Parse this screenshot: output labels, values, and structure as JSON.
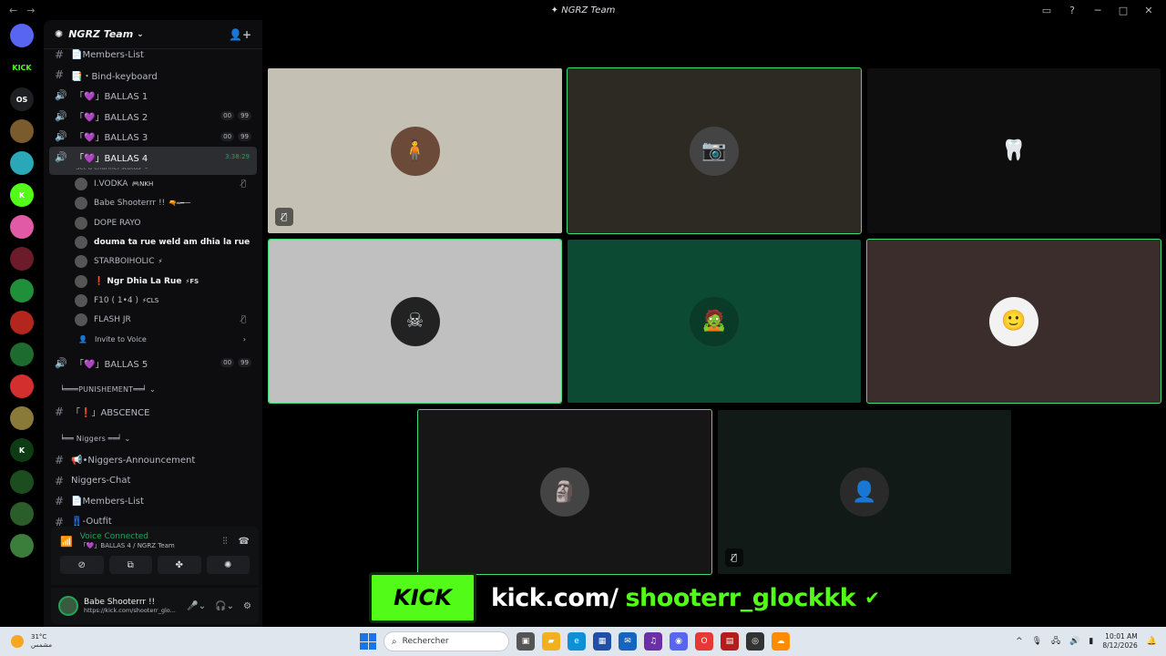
{
  "window": {
    "title": "NGRZ Team"
  },
  "rail": {
    "servers": [
      {
        "label": "",
        "color": "#5865f2",
        "icon": "discord-icon"
      },
      {
        "label": "KICK",
        "color": "#000000",
        "icon": "kick-logo"
      },
      {
        "label": "OS",
        "color": "#1e1f22",
        "icon": ""
      },
      {
        "label": "",
        "color": "#7a5b2e",
        "icon": ""
      },
      {
        "label": "",
        "color": "#2aa8b8",
        "icon": ""
      },
      {
        "label": "K",
        "color": "#53fc18",
        "icon": ""
      },
      {
        "label": "",
        "color": "#e05aa6",
        "icon": ""
      },
      {
        "label": "",
        "color": "#6b1b2a",
        "icon": ""
      },
      {
        "label": "",
        "color": "#1f8f3a",
        "icon": ""
      },
      {
        "label": "",
        "color": "#b3261e",
        "icon": ""
      },
      {
        "label": "",
        "color": "#1d6b2e",
        "icon": ""
      },
      {
        "label": "",
        "color": "#d32f2f",
        "icon": ""
      },
      {
        "label": "",
        "color": "#8a7a3a",
        "icon": ""
      },
      {
        "label": "K",
        "color": "#0d3b14",
        "icon": ""
      },
      {
        "label": "",
        "color": "#1b4d1e",
        "icon": ""
      },
      {
        "label": "",
        "color": "#2b5d2b",
        "icon": ""
      },
      {
        "label": "",
        "color": "#3b7d3b",
        "icon": ""
      }
    ]
  },
  "guild": {
    "name": "NGRZ Team"
  },
  "channels": {
    "members_list_top": "📄Members-List",
    "bind_keyboard": "📑・Bind-keyboard",
    "ballas1": "「💜」BALLAS 1",
    "ballas2": "「💜」BALLAS 2",
    "ballas3": "「💜」BALLAS 3",
    "ballas4": "「💜」BALLAS 4",
    "ballas4_timer": "3:38:29",
    "ballas4_status": "Set a channel status ✎",
    "ballas5": "「💜」BALLAS 5",
    "pill_a": "00",
    "pill_b": "99",
    "punishement_cat": "╘═══PUNISHEMENT══╛ ⌄",
    "abscence": "「❗」ABSCENCE",
    "niggers_cat": "╘══ Niggers ══╛ ⌄",
    "announcement": "📢•Niggers-Announcement",
    "chat": "Niggers-Chat",
    "members_list": "📄Members-List",
    "outfit": "👖-Outfit"
  },
  "voice_users": [
    {
      "name": "I.VODKA",
      "tag": "🎮NKH",
      "muted": true,
      "bold": false
    },
    {
      "name": "Babe Shooterrr !!",
      "tag": "🔫═━一",
      "muted": false,
      "bold": false
    },
    {
      "name": "DOPE RAYO",
      "tag": "",
      "muted": false,
      "bold": false
    },
    {
      "name": "douma ta rue weld am dhia la rue",
      "tag": "",
      "muted": false,
      "bold": true
    },
    {
      "name": "STARBOIHOLIC",
      "tag": "⚡",
      "muted": false,
      "bold": false
    },
    {
      "name": "❗ Ngr Dhia La Rue",
      "tag": "⚡FS",
      "muted": false,
      "bold": true
    },
    {
      "name": "F10 ( 1•4 )",
      "tag": "⚡CLS",
      "muted": false,
      "bold": false
    },
    {
      "name": "FLASH JR",
      "tag": "",
      "muted": true,
      "bold": false
    }
  ],
  "invite": "Invite to Voice",
  "voice_panel": {
    "title": "Voice Connected",
    "sub": "「💜」BALLAS 4 / NGRZ Team"
  },
  "user_panel": {
    "name": "Babe Shooterrr !!",
    "status": "https://kick.com/shooterr_glo..."
  },
  "tiles": [
    {
      "bg": "#c4c0b4",
      "avatar": "#6b4a3a",
      "glyph": "🧍",
      "speaking": false,
      "muted": true
    },
    {
      "bg": "#2c2a22",
      "avatar": "#444444",
      "glyph": "📷",
      "speaking": true,
      "muted": false
    },
    {
      "bg": "#0e0e0e",
      "avatar": "#0e0e0e",
      "glyph": "🦷",
      "speaking": false,
      "muted": false
    },
    {
      "bg": "#c0c0c0",
      "avatar": "#222222",
      "glyph": "☠",
      "speaking": true,
      "muted": false
    },
    {
      "bg": "#0c4a33",
      "avatar": "#0a3a28",
      "glyph": "🧟",
      "speaking": false,
      "muted": false
    },
    {
      "bg": "#3a2d2c",
      "avatar": "#f2f2f2",
      "glyph": "🙂",
      "speaking": true,
      "muted": false
    },
    {
      "bg": "#161616",
      "avatar": "#444444",
      "glyph": "🗿",
      "speaking": true,
      "muted": false
    },
    {
      "bg": "#111a17",
      "avatar": "#2a2a2a",
      "glyph": "👤",
      "speaking": false,
      "muted": true
    }
  ],
  "kick_banner": {
    "logo": "KICK",
    "url": "kick.com/",
    "user": "shooterr_glockkk"
  },
  "taskbar": {
    "weather_temp": "31°C",
    "weather_desc": "مشمس",
    "search_placeholder": "Rechercher",
    "time": "10:01 AM",
    "date": "8/12/2026"
  }
}
